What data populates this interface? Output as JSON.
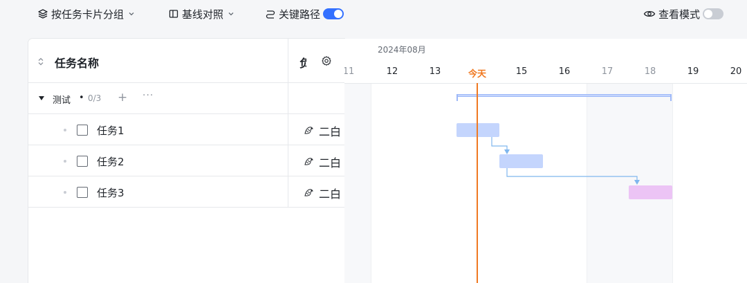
{
  "toolbar": {
    "group_by_label": "按任务卡片分组",
    "baseline_label": "基线对照",
    "critical_path_label": "关键路径",
    "critical_path_enabled": true,
    "view_mode_label": "查看模式",
    "view_mode_enabled": false
  },
  "table": {
    "name_header": "任务名称",
    "owner_header": "负",
    "group": {
      "name": "测试",
      "separator": "•",
      "progress": "0/3",
      "add_symbol": "+",
      "more_symbol": "···"
    },
    "tasks": [
      {
        "name": "任务1",
        "owner": "二白"
      },
      {
        "name": "任务2",
        "owner": "二白"
      },
      {
        "name": "任务3",
        "owner": "二白"
      }
    ]
  },
  "gantt": {
    "month_label": "2024年08月",
    "days": [
      {
        "label": "11",
        "weekend": true
      },
      {
        "label": "12",
        "weekend": false
      },
      {
        "label": "13",
        "weekend": false
      },
      {
        "label": "今天",
        "weekend": false,
        "today": true
      },
      {
        "label": "15",
        "weekend": false
      },
      {
        "label": "16",
        "weekend": false
      },
      {
        "label": "17",
        "weekend": true
      },
      {
        "label": "18",
        "weekend": true
      },
      {
        "label": "19",
        "weekend": false
      },
      {
        "label": "20",
        "weekend": false
      }
    ],
    "bars": [
      {
        "task": "任务1",
        "start_day": "14",
        "end_day": "15",
        "color": "#c4d5fd"
      },
      {
        "task": "任务2",
        "start_day": "15",
        "end_day": "16",
        "color": "#c4d5fd"
      },
      {
        "task": "任务3",
        "start_day": "18",
        "end_day": "18",
        "color": "#ecc4f5"
      }
    ],
    "colors": {
      "today": "#f07820",
      "accent": "#3370ff",
      "dependency": "#7fb6ee"
    }
  }
}
